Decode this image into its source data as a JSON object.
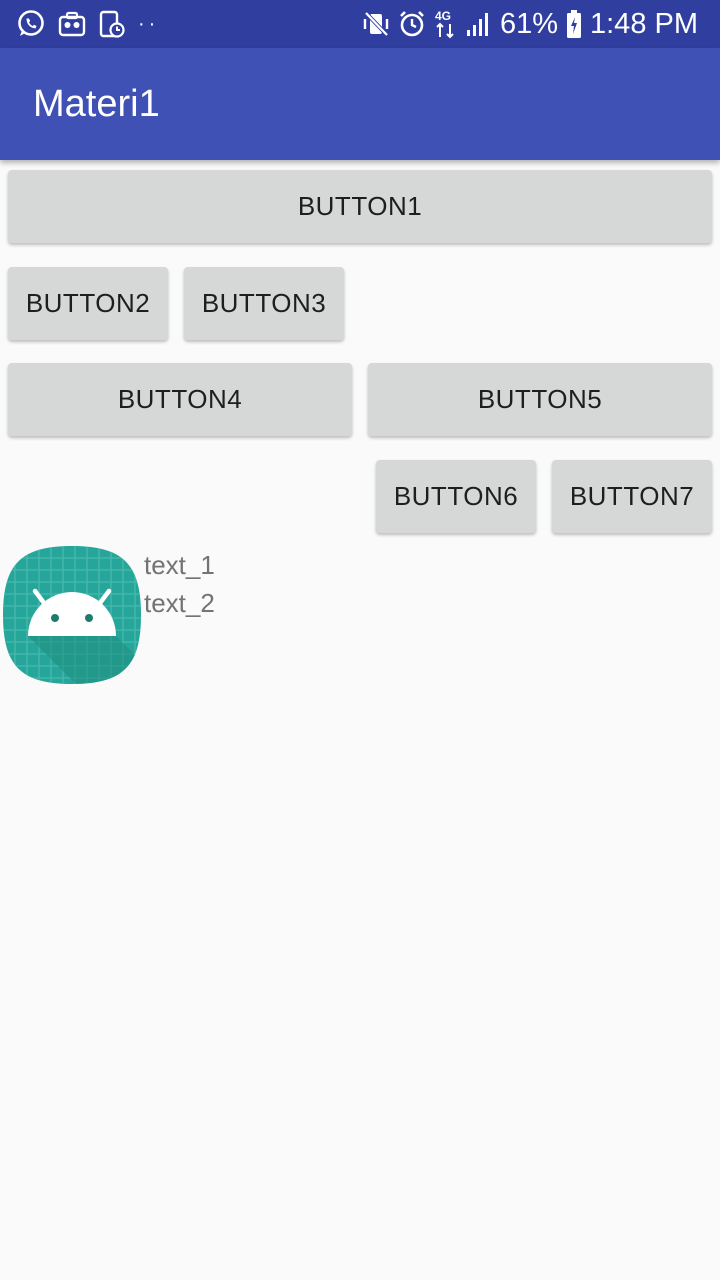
{
  "status_bar": {
    "battery": "61%",
    "time": "1:48 PM",
    "network": "4G",
    "left_icons": [
      "whatsapp-icon",
      "toolbox-icon",
      "screen-timer-icon",
      "more-dots-icon"
    ],
    "right_icons": [
      "vibrate-mute-icon",
      "alarm-icon",
      "data-arrows-icon",
      "signal-icon",
      "battery-charging-icon"
    ]
  },
  "app_bar": {
    "title": "Materi1",
    "color": "#3f51b5"
  },
  "buttons": {
    "b1": "BUTTON1",
    "b2": "BUTTON2",
    "b3": "BUTTON3",
    "b4": "BUTTON4",
    "b5": "BUTTON5",
    "b6": "BUTTON6",
    "b7": "BUTTON7"
  },
  "content": {
    "image": "android-launcher-icon",
    "text1": "text_1",
    "text2": "text_2"
  },
  "colors": {
    "status_bar": "#303f9f",
    "app_bar": "#3f51b5",
    "button": "#d6d7d7",
    "background": "#fafafa",
    "launcher_teal": "#26a69a"
  }
}
